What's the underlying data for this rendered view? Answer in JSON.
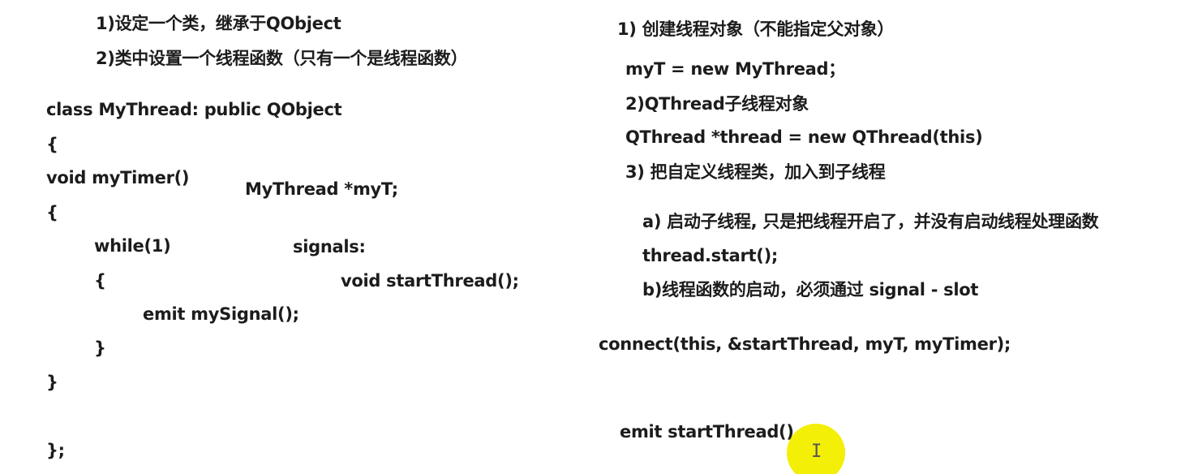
{
  "left": {
    "step1": "1)设定一个类，继承于QObject",
    "step2": "2)类中设置一个线程函数（只有一个是线程函数）",
    "class_decl": "class MyThread: public QObject",
    "open_brace": "{",
    "func_decl": "void myTimer()",
    "func_open": "{",
    "while_stmt": "while(1)",
    "while_open": "{",
    "emit_stmt": "emit mySignal();",
    "while_close": "}",
    "func_close": "}",
    "class_close": "};"
  },
  "middle": {
    "member_decl": "MyThread *myT;",
    "signals_label": "signals:",
    "signal_decl": "void startThread();"
  },
  "right": {
    "step1": "1) 创建线程对象（不能指定父对象）",
    "create_obj": "myT = new MyThread；",
    "step2": "2)QThread子线程对象",
    "create_thread": "QThread *thread = new QThread(this)",
    "step3": "3) 把自定义线程类，加入到子线程",
    "sub_a": "a) 启动子线程, 只是把线程开启了，并没有启动线程处理函数",
    "thread_start": "thread.start();",
    "sub_b": "b)线程函数的启动，必须通过 signal - slot",
    "connect_stmt": "connect(this, &startThread, myT, myTimer);",
    "emit_stmt": "emit startThread()"
  },
  "cursor": {
    "icon": "text-cursor-icon",
    "highlight_color": "#f3ef06"
  }
}
